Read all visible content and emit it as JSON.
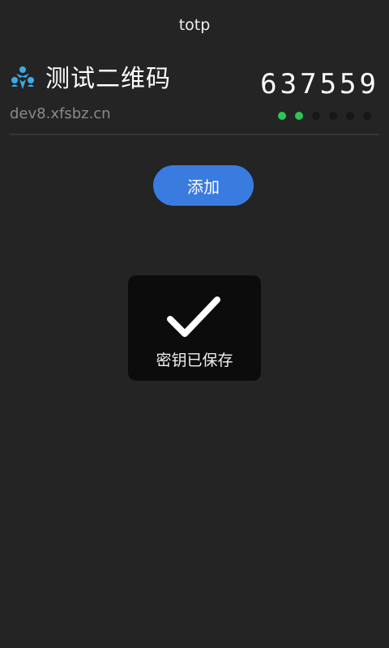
{
  "app": {
    "title": "totp"
  },
  "entry": {
    "logo_icon": "people-logo-icon",
    "name": "测试二维码",
    "issuer": "dev8.xfsbz.cn",
    "code": "637559",
    "countdown_dots": {
      "total": 6,
      "active": 2
    }
  },
  "actions": {
    "add_label": "添加"
  },
  "toast": {
    "icon": "checkmark-icon",
    "message": "密钥已保存"
  },
  "colors": {
    "accent": "#3a7be0",
    "active_dot": "#2dc653",
    "background": "#242424"
  }
}
